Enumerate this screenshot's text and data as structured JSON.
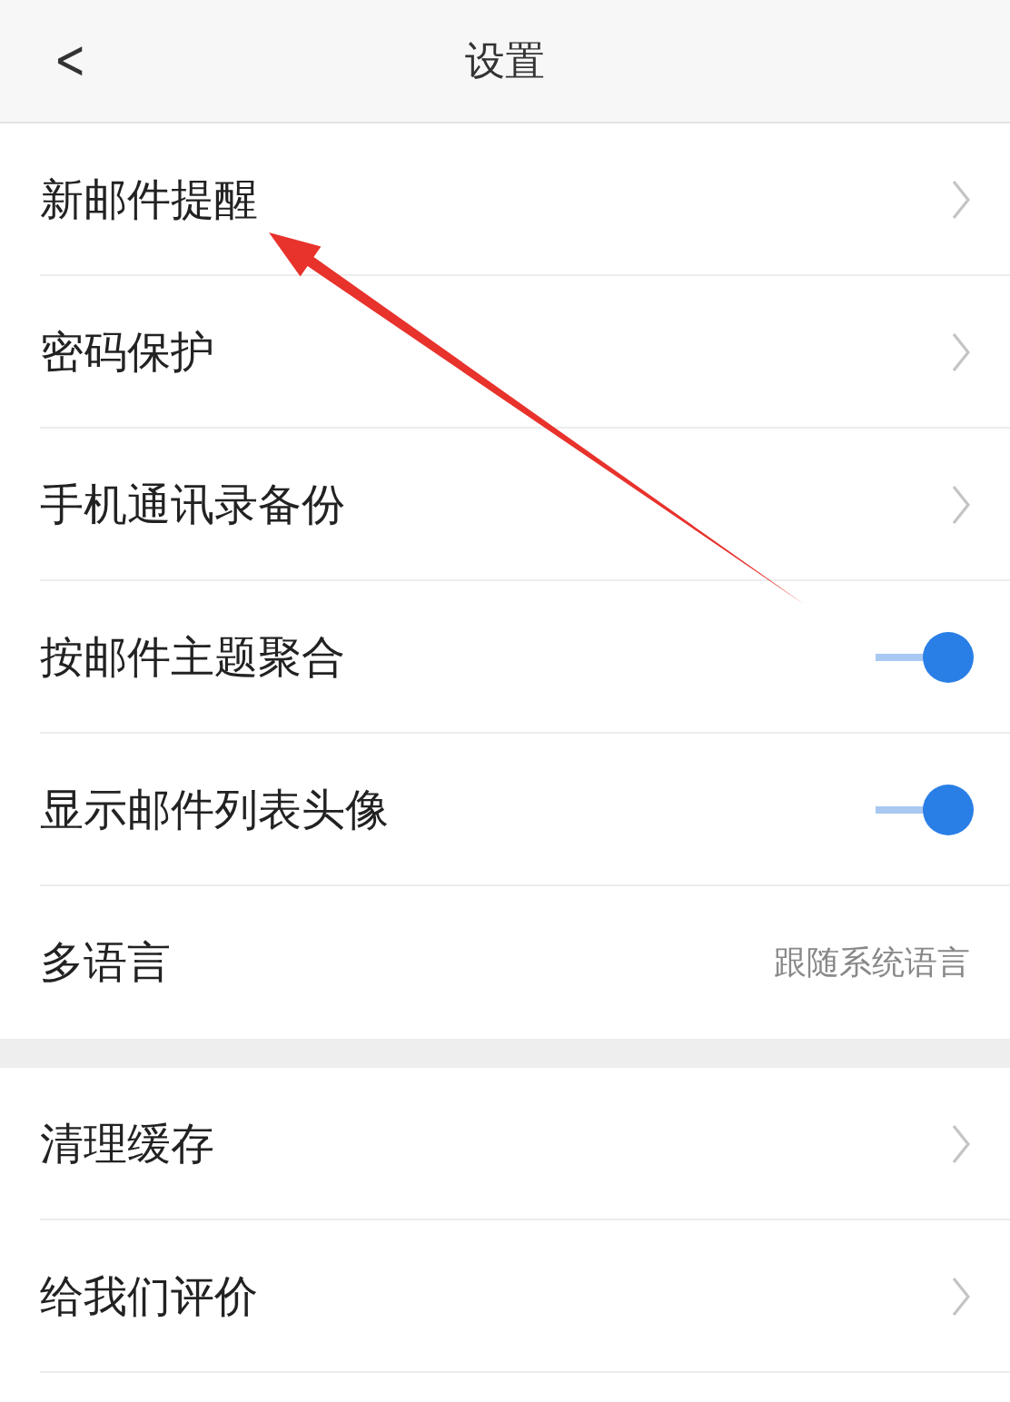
{
  "header": {
    "back": "<",
    "title": "设置"
  },
  "sections": [
    {
      "items": [
        {
          "kind": "link",
          "label": "新邮件提醒"
        },
        {
          "kind": "link",
          "label": "密码保护"
        },
        {
          "kind": "link",
          "label": "手机通讯录备份"
        },
        {
          "kind": "toggle",
          "label": "按邮件主题聚合",
          "on": true
        },
        {
          "kind": "toggle",
          "label": "显示邮件列表头像",
          "on": true
        },
        {
          "kind": "value",
          "label": "多语言",
          "value": "跟随系统语言"
        }
      ]
    },
    {
      "items": [
        {
          "kind": "link",
          "label": "清理缓存"
        },
        {
          "kind": "link",
          "label": "给我们评价"
        }
      ]
    }
  ],
  "annotation": {
    "kind": "arrow"
  }
}
